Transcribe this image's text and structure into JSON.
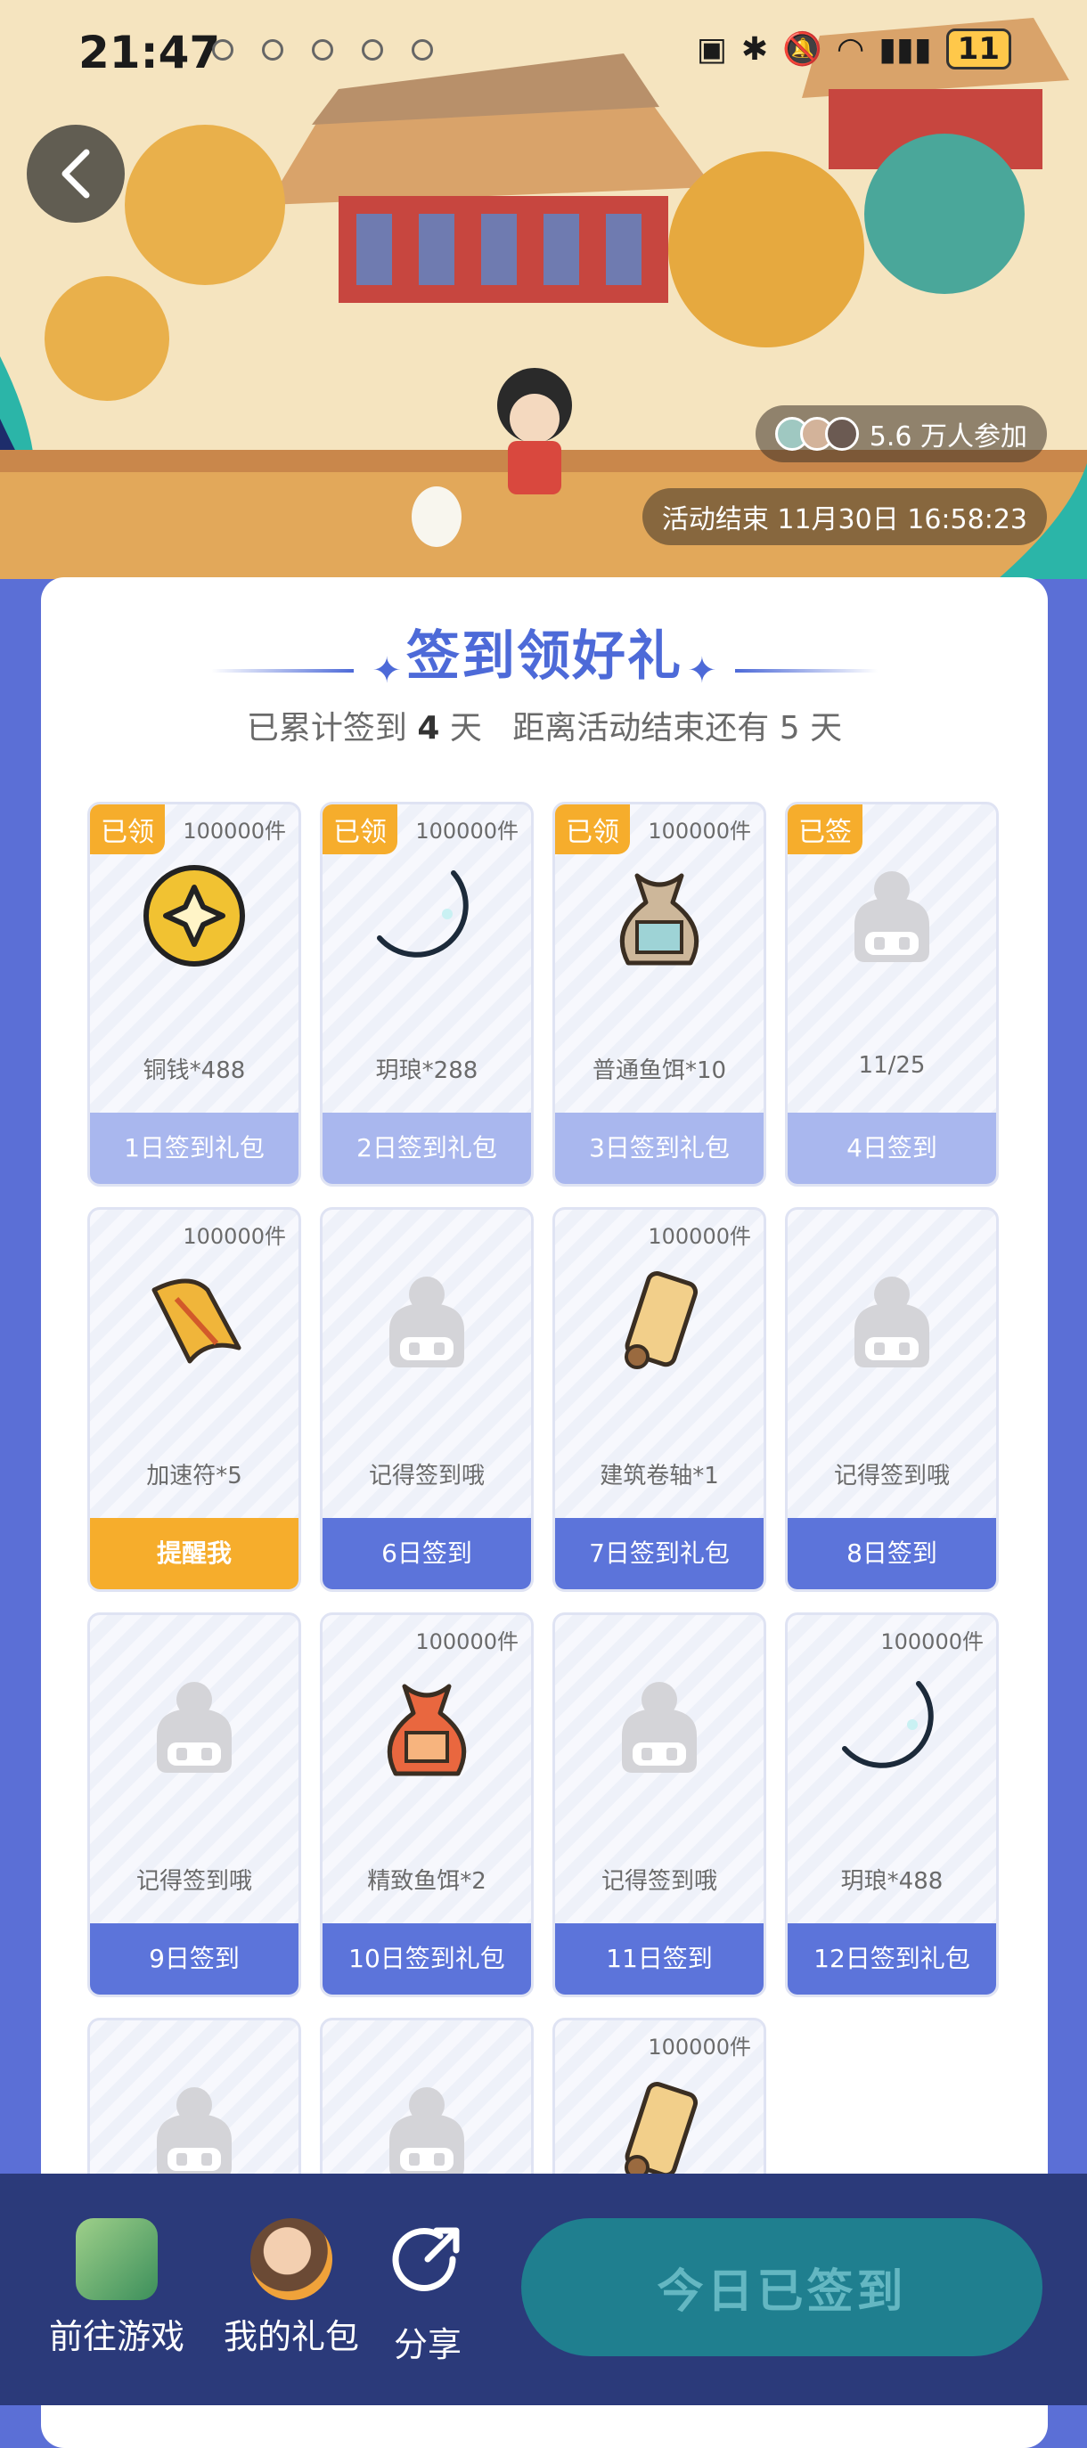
{
  "status_bar": {
    "time": "21:47",
    "battery": "11"
  },
  "banner": {
    "participants_text": "5.6 万人参加",
    "end_time_text": "活动结束 11月30日 16:58:23"
  },
  "checkin": {
    "title": "签到领好礼",
    "subtitle_prefix": "已累计签到",
    "signed_days": "4",
    "unit_day": "天",
    "remaining_prefix": "距离活动结束还有",
    "remaining_days": "5",
    "tiles": [
      {
        "tag": "已领",
        "qty": "100000件",
        "label": "铜钱*488",
        "button": "1日签到礼包",
        "icon": "coin-icon",
        "state": "done"
      },
      {
        "tag": "已领",
        "qty": "100000件",
        "label": "玥琅*288",
        "button": "2日签到礼包",
        "icon": "moon-jade-icon",
        "state": "done"
      },
      {
        "tag": "已领",
        "qty": "100000件",
        "label": "普通鱼饵*10",
        "button": "3日签到礼包",
        "icon": "bait-bag-icon",
        "state": "done"
      },
      {
        "tag": "已签",
        "qty": "",
        "label": "11/25",
        "button": "4日签到",
        "icon": "placeholder-character-icon",
        "state": "done"
      },
      {
        "tag": "",
        "qty": "100000件",
        "label": "加速符*5",
        "button": "提醒我",
        "icon": "talisman-icon",
        "state": "remind"
      },
      {
        "tag": "",
        "qty": "",
        "label": "记得签到哦",
        "button": "6日签到",
        "icon": "placeholder-character-icon",
        "state": "future"
      },
      {
        "tag": "",
        "qty": "100000件",
        "label": "建筑卷轴*1",
        "button": "7日签到礼包",
        "icon": "scroll-icon",
        "state": "future"
      },
      {
        "tag": "",
        "qty": "",
        "label": "记得签到哦",
        "button": "8日签到",
        "icon": "placeholder-character-icon",
        "state": "future"
      },
      {
        "tag": "",
        "qty": "",
        "label": "记得签到哦",
        "button": "9日签到",
        "icon": "placeholder-character-icon",
        "state": "future"
      },
      {
        "tag": "",
        "qty": "100000件",
        "label": "精致鱼饵*2",
        "button": "10日签到礼包",
        "icon": "fine-bait-bag-icon",
        "state": "future"
      },
      {
        "tag": "",
        "qty": "",
        "label": "记得签到哦",
        "button": "11日签到",
        "icon": "placeholder-character-icon",
        "state": "future"
      },
      {
        "tag": "",
        "qty": "100000件",
        "label": "玥琅*488",
        "button": "12日签到礼包",
        "icon": "moon-jade-icon",
        "state": "future"
      },
      {
        "tag": "",
        "qty": "",
        "label": "",
        "button": "",
        "icon": "placeholder-character-icon",
        "state": "future"
      },
      {
        "tag": "",
        "qty": "",
        "label": "",
        "button": "",
        "icon": "placeholder-character-icon",
        "state": "future"
      },
      {
        "tag": "",
        "qty": "100000件",
        "label": "",
        "button": "",
        "icon": "scroll-icon",
        "state": "future"
      }
    ]
  },
  "bottom_bar": {
    "go_game": "前往游戏",
    "my_gifts": "我的礼包",
    "share": "分享",
    "signed_today": "今日已签到"
  },
  "colors": {
    "accent": "#4d6ad8",
    "tag": "#f6ad2c",
    "done_button": "#a9b7ee",
    "future_button": "#5c74da",
    "bottom_bar": "#2b3a7a"
  }
}
